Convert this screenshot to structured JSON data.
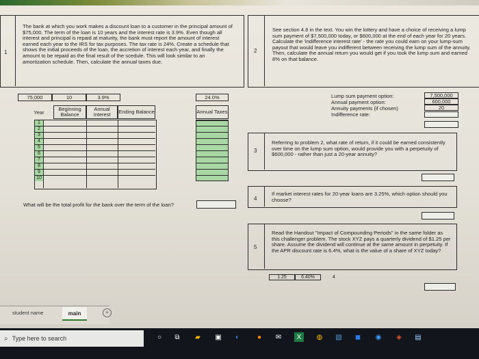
{
  "problem1": {
    "number": "1",
    "text": "The bank at which you work makes a discount loan to a customer in the principal amount of $75,000. The term of the loan is 10 years and the interest rate is 3.9%. Even though all interest and principal is repaid at maturity, the bank must report the amount of interest earned each year to the IRS for tax purposes. The tax rate is 24%. Create a schedule that shows the initial proceeds of the loan, the accretion of interest each year, and finally the amount to be repaid as the final result of the scedule. This will look similar to an amortization schedule. Then, calculate the annual taxes due.",
    "principal": "75,000",
    "years": "10",
    "rate": "3.9%",
    "tax_rate": "24.0%",
    "col_year": "Year",
    "col_beginning": "Beginning Balance",
    "col_interest": "Annual Interest",
    "col_ending": "Ending Balance",
    "col_taxes": "Annual Taxes",
    "rows": [
      "1",
      "2",
      "3",
      "4",
      "5",
      "6",
      "7",
      "8",
      "9",
      "10"
    ],
    "profit_question": "What will be the total profit for the bank over the term of the loan?"
  },
  "problem2": {
    "number": "2",
    "text": "See section 4.8 in the text. You win the lottery and have a choice of receiving a lump sum payment of $7,500,000 today, or $600,000 at the end of each year for 20 years. Calculate the 'indifference interest rate' - the rate you could earn on your lump-sum payout that would leave you indifferent between receiving the lump sum of the annuity. Then, calculate the annual return you would get if you took the lump sum and earned 8% on that balance.",
    "label_lump": "Lump sum payment option:",
    "label_annual": "Annual payment option:",
    "label_annuity": "Annuity payments (if chosen)",
    "label_indiff": "Indifference rate:",
    "value_lump": "7,500,000",
    "value_annual": "600,000",
    "value_annuity": "20"
  },
  "problem3": {
    "number": "3",
    "text": "Referring to problem 2, what rate of return, if it could be earned consistently over time on the lump sum option, would provide you with a perpetuity of $600,000 - rather than just a 20-year annuity?"
  },
  "problem4": {
    "number": "4",
    "text": "If market interest rates for 20-year loans are 3.25%, which option should you choose?"
  },
  "problem5": {
    "number": "5",
    "text": "Read the Handout \"Impact of Compounding Periods\" in the same folder as this challenger problem. The stock XYZ pays a quarterly dividend of $1.25 per share. Assume the dividend will continue at the same amount in perpetuity. If the APR discount rate is 6.4%, what is the value of a share of XYZ today?",
    "dividend": "1.25",
    "apr": "6.40%",
    "periods": "4"
  },
  "tabs": {
    "items": [
      "student name",
      "main"
    ],
    "add": "+"
  },
  "taskbar": {
    "search_placeholder": "Type here to search"
  }
}
